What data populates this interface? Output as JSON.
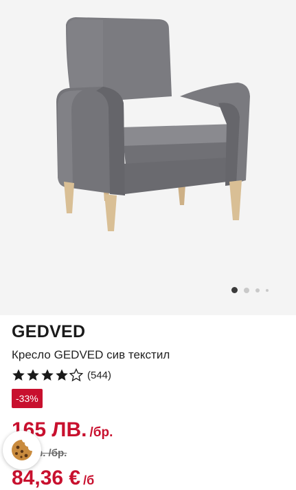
{
  "product": {
    "brand": "GEDVED",
    "description": "Кресло GEDVED сив текстил",
    "rating": {
      "stars_filled": 4,
      "stars_total": 5,
      "count": "(544)"
    },
    "discount_badge": "-33%",
    "price": {
      "amount": "165 ЛВ.",
      "unit": "/бр."
    },
    "old_price": "в. /бр.",
    "eur_price": {
      "amount": "84,36 €",
      "unit": "/б"
    }
  },
  "gallery": {
    "slide_count": 4,
    "active_slide": 1
  },
  "colors": {
    "accent_red": "#c8102e",
    "gallery_bg": "#f4f4f4",
    "fabric_gray": "#76767b",
    "wood": "#d9bf95"
  },
  "icons": {
    "cookie": "cookie-icon",
    "star": "star-icon"
  }
}
